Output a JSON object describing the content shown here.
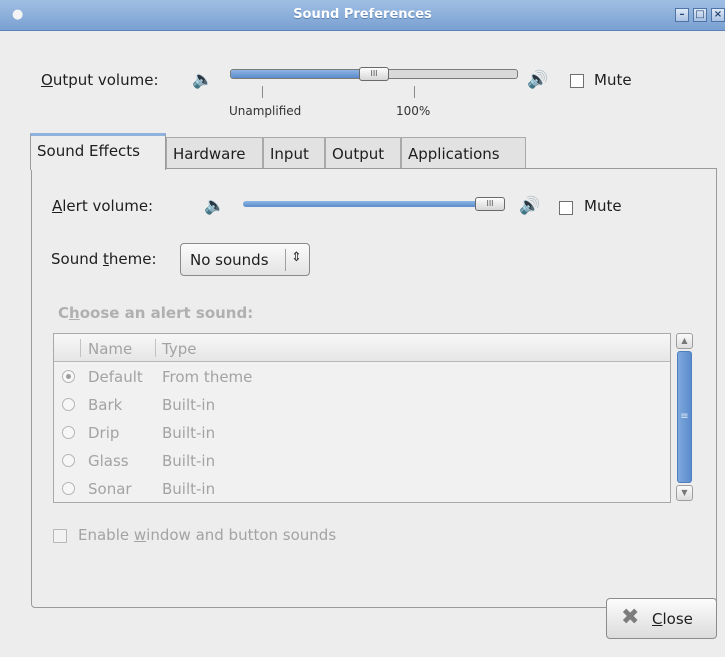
{
  "window": {
    "title": "Sound Preferences",
    "app_icon": "foot-icon",
    "controls": [
      "minimize-icon",
      "maximize-icon",
      "close-icon"
    ]
  },
  "output": {
    "label_mnemonic": "O",
    "label_rest": "utput volume:",
    "level_percent": 50,
    "tick_unamplified": "Unamplified",
    "tick_100": "100%",
    "mute_label": "Mute",
    "mute_checked": false
  },
  "tabs": [
    {
      "label": "Sound Effects",
      "active": true
    },
    {
      "label": "Hardware"
    },
    {
      "label": "Input"
    },
    {
      "label": "Output"
    },
    {
      "label": "Applications"
    }
  ],
  "effects": {
    "alert_mnemonic": "A",
    "alert_rest": "lert volume:",
    "alert_level_percent": 100,
    "mute_label": "Mute",
    "mute_checked": false,
    "theme_pre": "Sound ",
    "theme_mnemonic": "t",
    "theme_post": "heme:",
    "theme_value": "No sounds",
    "choose_pre": "C",
    "choose_mnemonic": "h",
    "choose_post": "oose an alert sound:",
    "columns": {
      "name": "Name",
      "type": "Type"
    },
    "sounds": [
      {
        "name": "Default",
        "type": "From theme",
        "selected": true
      },
      {
        "name": "Bark",
        "type": "Built-in"
      },
      {
        "name": "Drip",
        "type": "Built-in"
      },
      {
        "name": "Glass",
        "type": "Built-in"
      },
      {
        "name": "Sonar",
        "type": "Built-in"
      }
    ],
    "enable_pre": "Enable ",
    "enable_mnemonic": "w",
    "enable_post": "indow and button sounds",
    "enable_checked": false
  },
  "close_button": {
    "mnemonic": "C",
    "rest": "lose"
  },
  "colors": {
    "titlebar": "#7aa1d2",
    "accent": "#5c8ccb",
    "disabled_text": "#a3a3a3"
  }
}
